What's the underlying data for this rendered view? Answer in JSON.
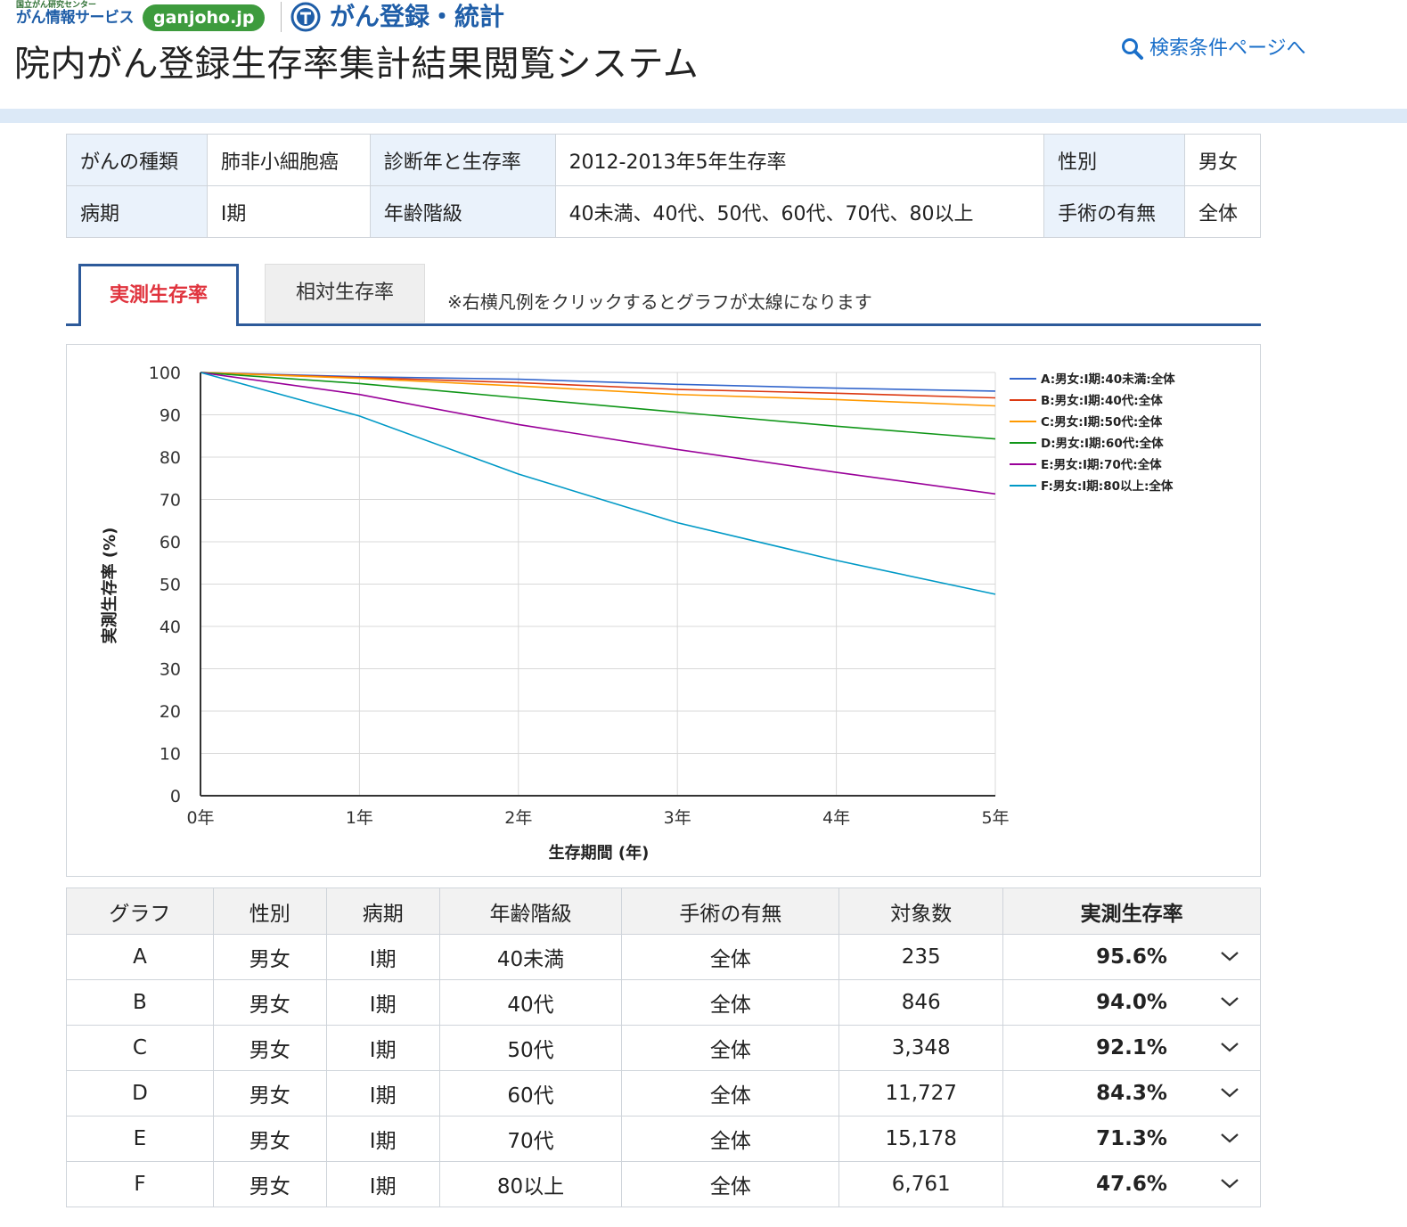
{
  "header": {
    "logo_small_line1": "国立がん研究センター",
    "logo_small_line2": "がん情報サービス",
    "logo_pill": "ganjoho.jp",
    "logo_title2": "がん登録・統計",
    "page_title": "院内がん登録生存率集計結果閲覧システム",
    "search_link": "検索条件ページへ"
  },
  "conditions": [
    [
      {
        "label": "がんの種類",
        "value": "肺非小細胞癌"
      },
      {
        "label": "診断年と生存率",
        "value": "2012-2013年5年生存率"
      },
      {
        "label": "性別",
        "value": "男女"
      }
    ],
    [
      {
        "label": "病期",
        "value": "Ⅰ期"
      },
      {
        "label": "年齢階級",
        "value": "40未満、40代、50代、60代、70代、80以上"
      },
      {
        "label": "手術の有無",
        "value": "全体"
      }
    ]
  ],
  "tabs": {
    "active": "実測生存率",
    "inactive": "相対生存率",
    "note": "※右横凡例をクリックするとグラフが太線になります"
  },
  "chart_data": {
    "type": "line",
    "xlabel": "生存期間 (年)",
    "ylabel": "実測生存率 (%)",
    "x": [
      "0年",
      "1年",
      "2年",
      "3年",
      "4年",
      "5年"
    ],
    "ylim": [
      0,
      100
    ],
    "yticks": [
      "100",
      "90",
      "80",
      "70",
      "60",
      "50",
      "40",
      "30",
      "20",
      "10",
      "0"
    ],
    "grid": true,
    "legend_position": "right",
    "series": [
      {
        "name": "A:男女:Ⅰ期:40未満:全体",
        "color": "#3366cc",
        "values": [
          100,
          99.0,
          98.4,
          97.2,
          96.3,
          95.6
        ]
      },
      {
        "name": "B:男女:Ⅰ期:40代:全体",
        "color": "#dc3912",
        "values": [
          100,
          98.8,
          97.6,
          96.0,
          95.1,
          94.0
        ]
      },
      {
        "name": "C:男女:Ⅰ期:50代:全体",
        "color": "#ff9900",
        "values": [
          100,
          98.6,
          96.8,
          94.8,
          93.6,
          92.1
        ]
      },
      {
        "name": "D:男女:Ⅰ期:60代:全体",
        "color": "#109618",
        "values": [
          100,
          97.4,
          94.0,
          90.6,
          87.3,
          84.3
        ]
      },
      {
        "name": "E:男女:Ⅰ期:70代:全体",
        "color": "#990099",
        "values": [
          100,
          94.8,
          87.7,
          81.8,
          76.4,
          71.3
        ]
      },
      {
        "name": "F:男女:Ⅰ期:80以上:全体",
        "color": "#0099c6",
        "values": [
          100,
          89.7,
          76.0,
          64.5,
          55.6,
          47.6
        ]
      }
    ]
  },
  "results": {
    "headers": [
      "グラフ",
      "性別",
      "病期",
      "年齢階級",
      "手術の有無",
      "対象数",
      "実測生存率"
    ],
    "rows": [
      [
        "A",
        "男女",
        "Ⅰ期",
        "40未満",
        "全体",
        "235",
        "95.6%"
      ],
      [
        "B",
        "男女",
        "Ⅰ期",
        "40代",
        "全体",
        "846",
        "94.0%"
      ],
      [
        "C",
        "男女",
        "Ⅰ期",
        "50代",
        "全体",
        "3,348",
        "92.1%"
      ],
      [
        "D",
        "男女",
        "Ⅰ期",
        "60代",
        "全体",
        "11,727",
        "84.3%"
      ],
      [
        "E",
        "男女",
        "Ⅰ期",
        "70代",
        "全体",
        "15,178",
        "71.3%"
      ],
      [
        "F",
        "男女",
        "Ⅰ期",
        "80以上",
        "全体",
        "6,761",
        "47.6%"
      ]
    ]
  }
}
